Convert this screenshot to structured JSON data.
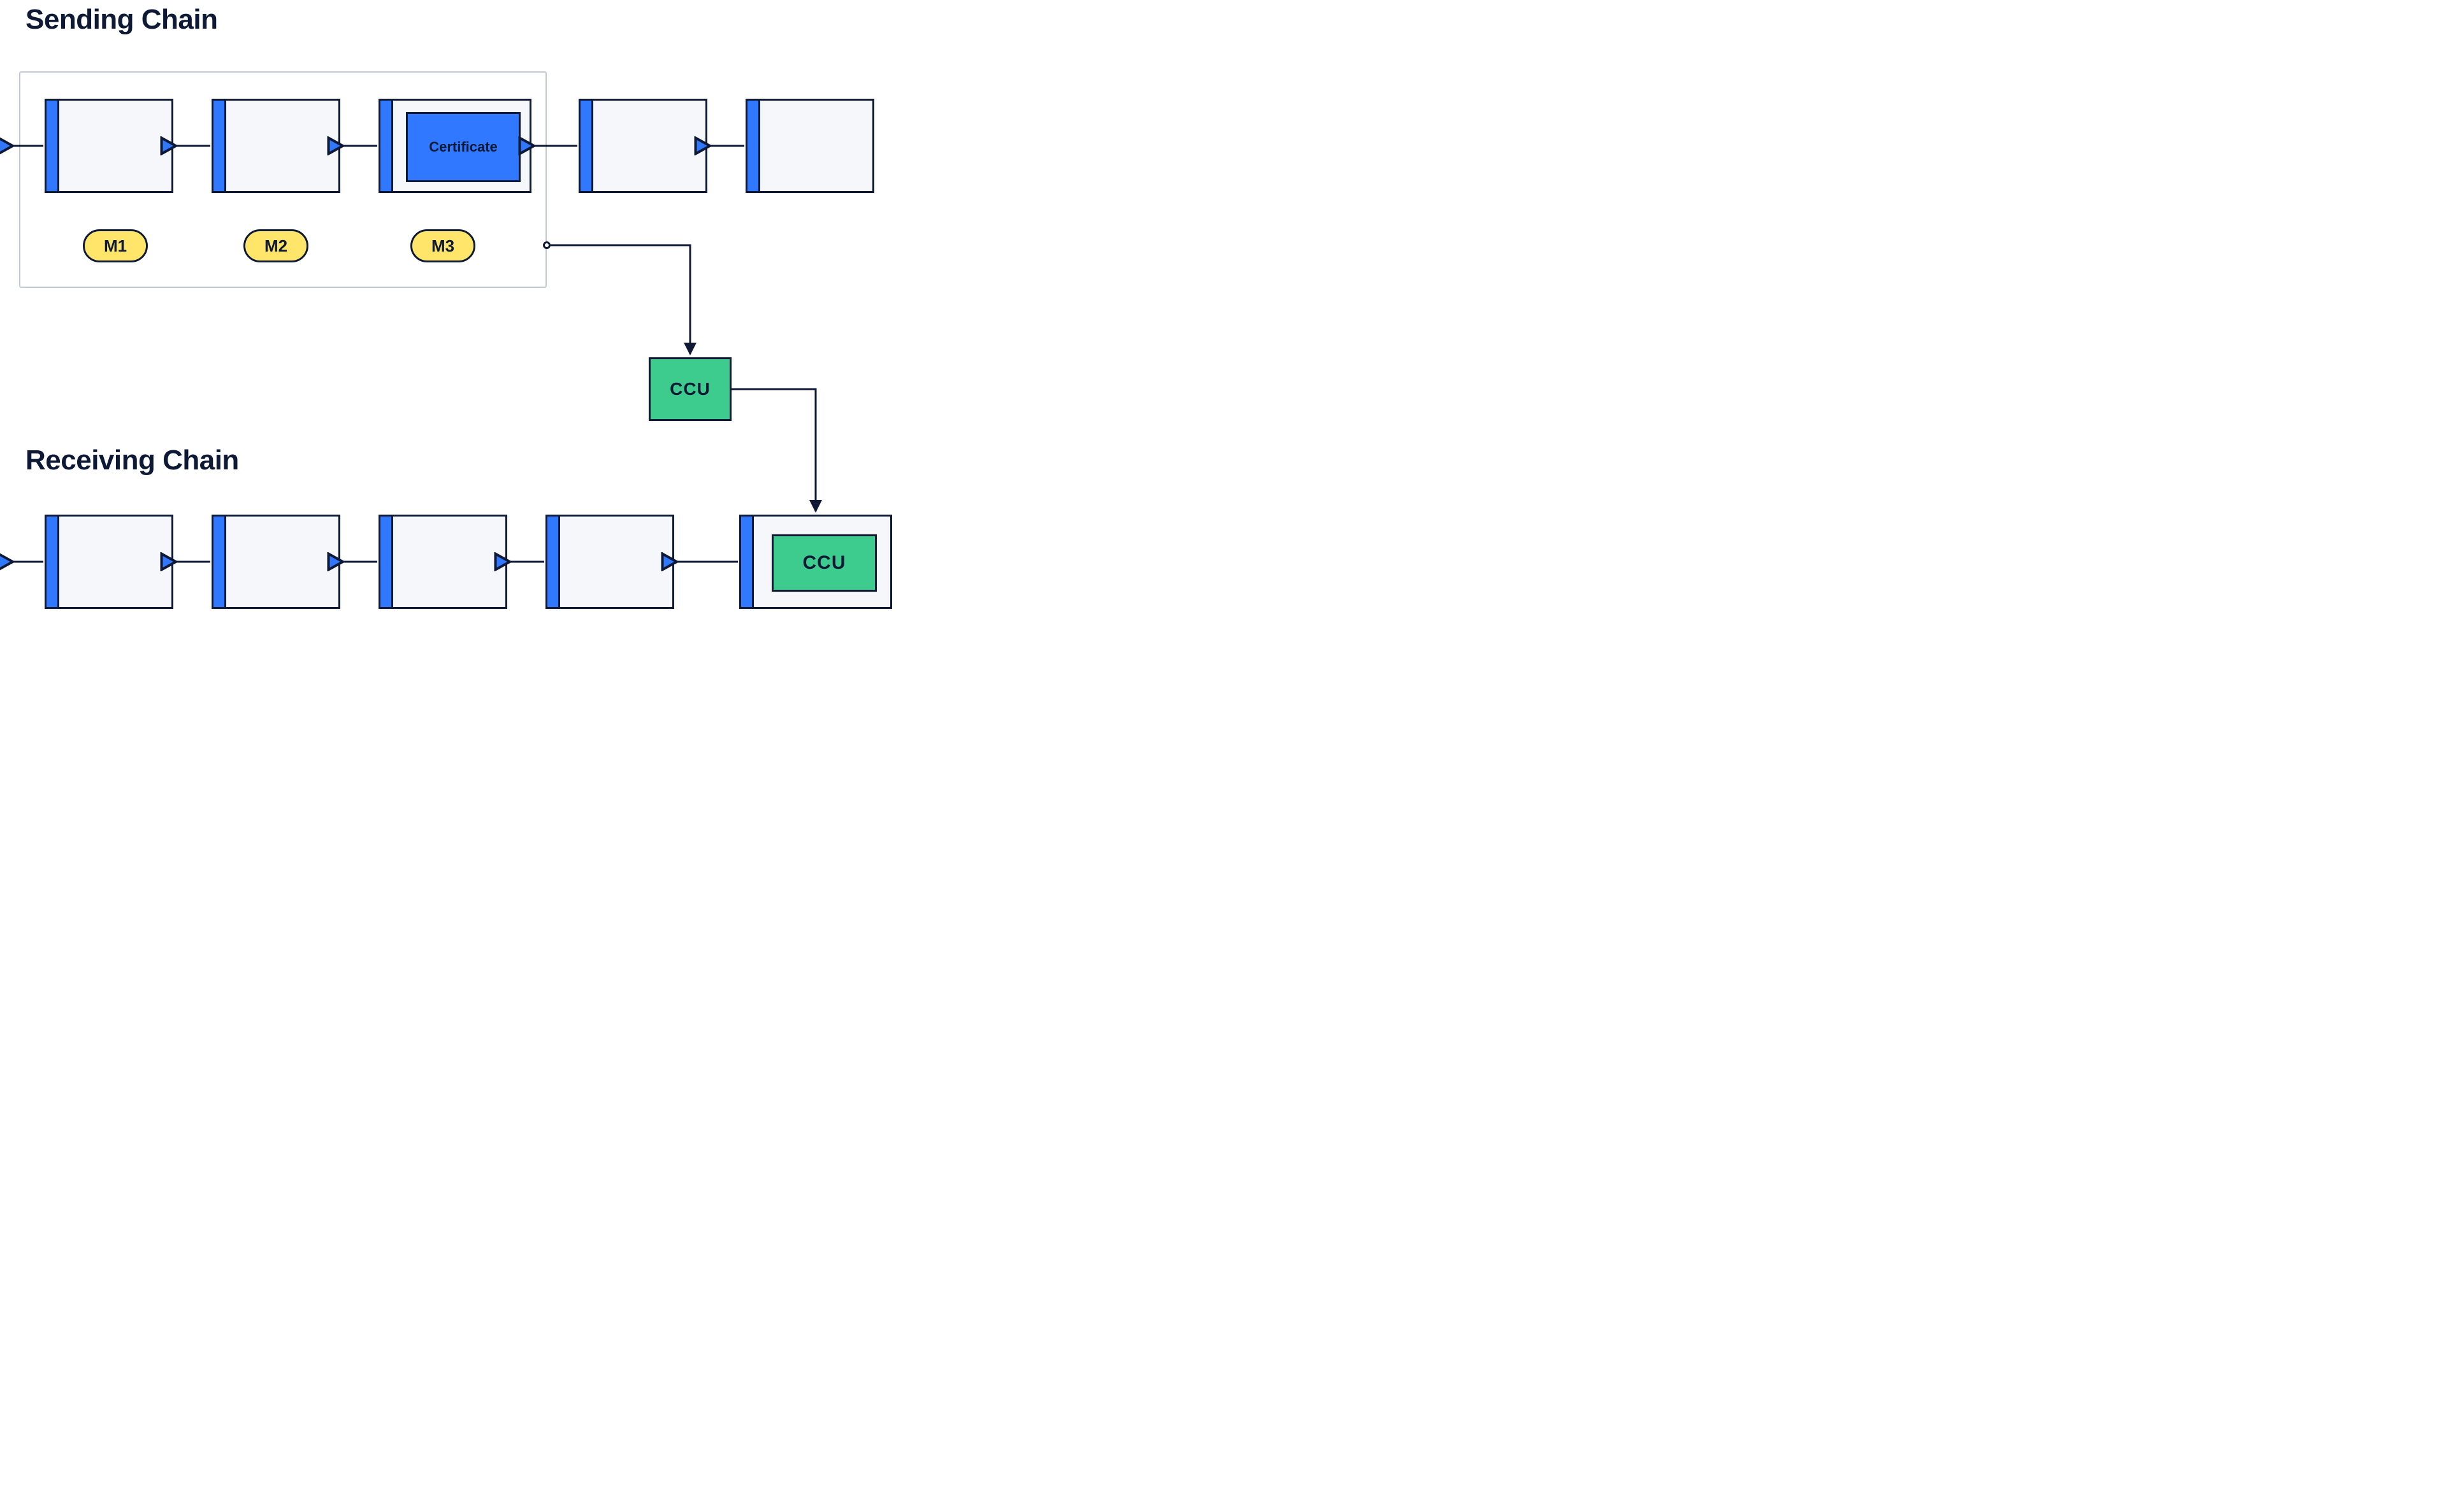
{
  "colors": {
    "ink": "#0e1a35",
    "block_fill": "#f6f7fa",
    "block_stripe": "#2f78ff",
    "pill": "#ffe56a",
    "ccu": "#3dcc8e",
    "bounding": "#c4c9d1"
  },
  "headings": {
    "sending": "Sending Chain",
    "receiving": "Receiving Chain"
  },
  "sending_chain": {
    "blocks": 5,
    "bounded_range": "blocks 1–3",
    "certificate_block_index": 3,
    "certificate_label": "Certificate",
    "pills": [
      "M1",
      "M2",
      "M3"
    ]
  },
  "ccu": {
    "label": "CCU"
  },
  "receiving_chain": {
    "blocks": 5,
    "ccu_block_index": 5,
    "ccu_inner_label": "CCU"
  }
}
